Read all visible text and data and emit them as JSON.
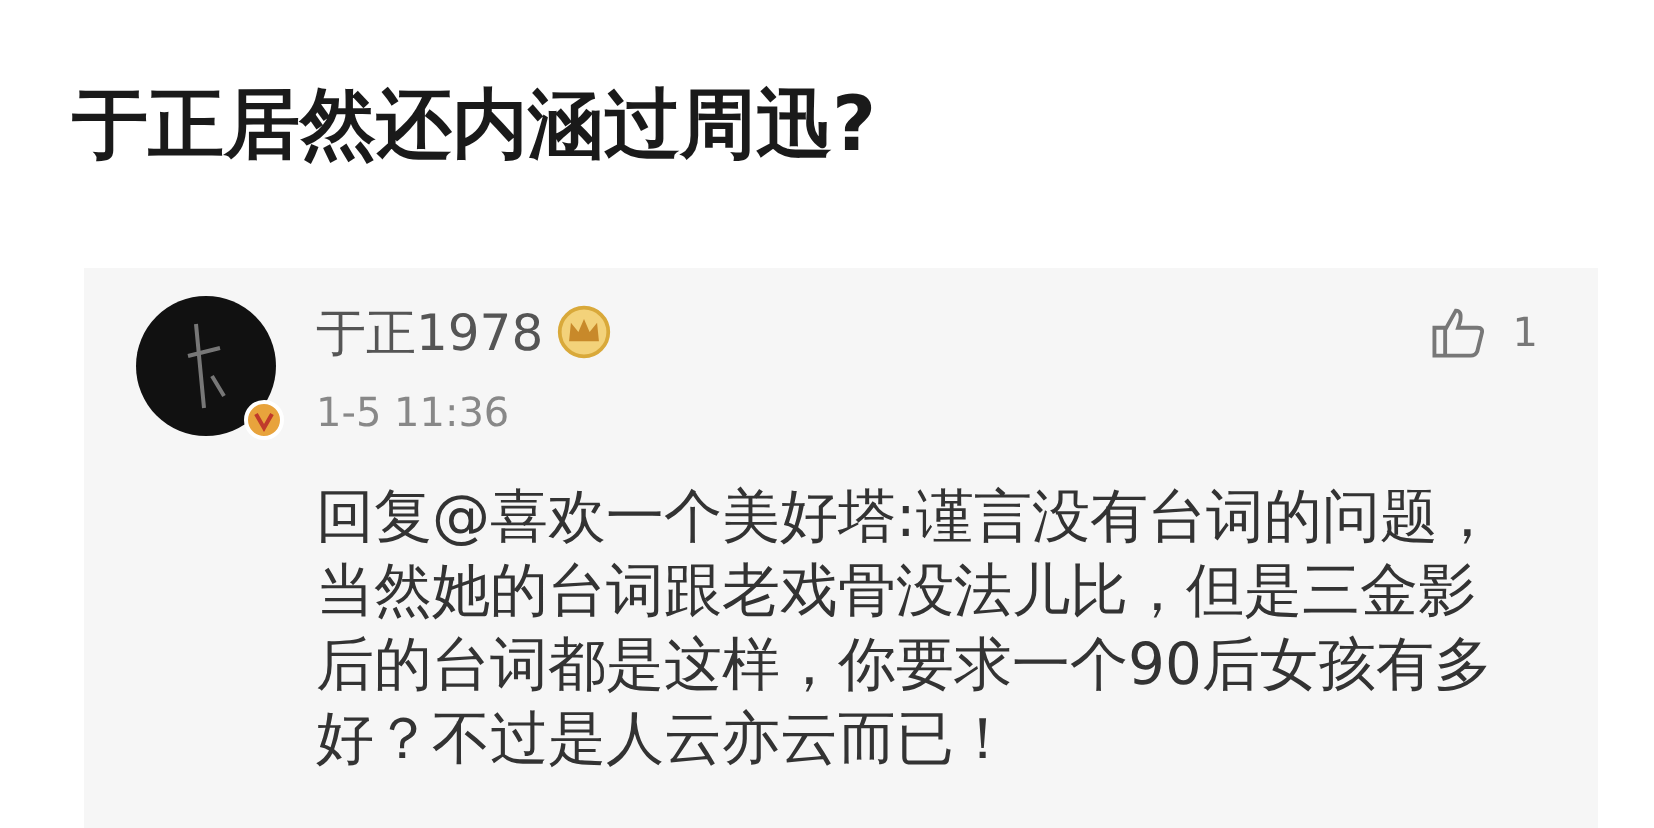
{
  "post": {
    "title": "于正居然还内涵过周迅?"
  },
  "comment": {
    "username": "于正1978",
    "verified": true,
    "likes": "1",
    "time": "1-5 11:36",
    "text": "回复@喜欢一个美好塔:谨言没有台词的问题，当然她的台词跟老戏骨没法儿比，但是三金影后的台词都是这样，你要求一个90后女孩有多好？不过是人云亦云而已！"
  }
}
